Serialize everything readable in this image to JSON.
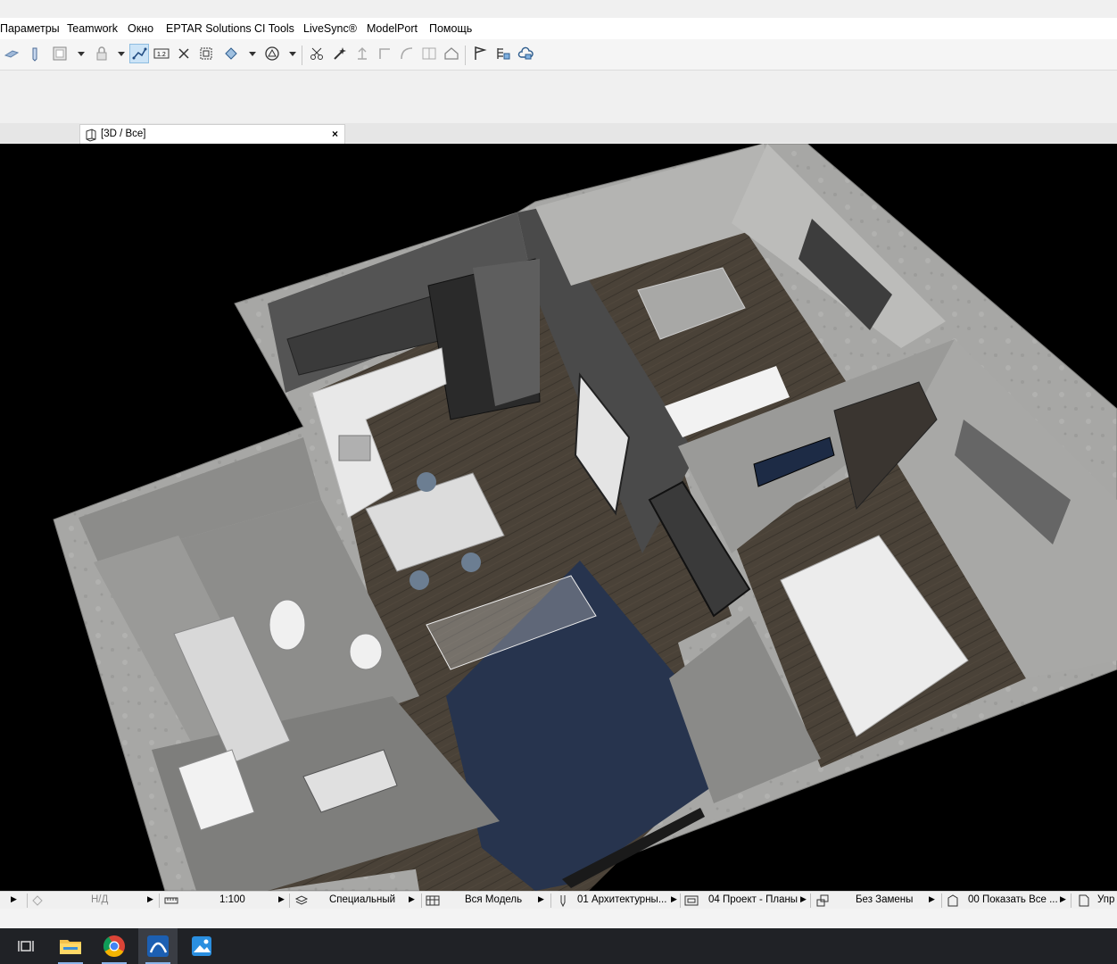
{
  "menu": [
    "Параметры",
    "Teamwork",
    "Окно",
    "EPTAR Solutions",
    "CI Tools",
    "LiveSync®",
    "ModelPort",
    "Помощь"
  ],
  "tab": {
    "label": "[3D / Все]",
    "close": "×"
  },
  "status": {
    "undo_value": "Н/Д",
    "scale": "1:100",
    "layer_combo": "Специальный",
    "model_view": "Вся Модель",
    "pen_set": "01 Архитектурны...",
    "view_set": "04 Проект - Планы",
    "renovation": "Без Замены",
    "filter": "00 Показать Все ...",
    "last": "Упр"
  },
  "icons": {
    "toolbar": [
      "slab-tool-icon",
      "pen-icon",
      "window-frame-icon",
      "lock-icon",
      "trace-icon",
      "dimension-icon",
      "snap-icon",
      "group-icon",
      "rotate-3d-icon",
      "shape-icon",
      "magic-wand-icon",
      "trim-icon",
      "elevate-icon",
      "corner-icon",
      "curve-icon",
      "split-icon",
      "house-icon",
      "flag-icon",
      "list-icon",
      "cloud-icon"
    ],
    "taskbar": [
      "task-view-icon",
      "file-explorer-icon",
      "chrome-icon",
      "archicad-icon",
      "photos-icon"
    ]
  },
  "colors": {
    "viewport_bg": "#000000",
    "taskbar_bg": "#202226",
    "active_tool": "#cce4f7"
  }
}
